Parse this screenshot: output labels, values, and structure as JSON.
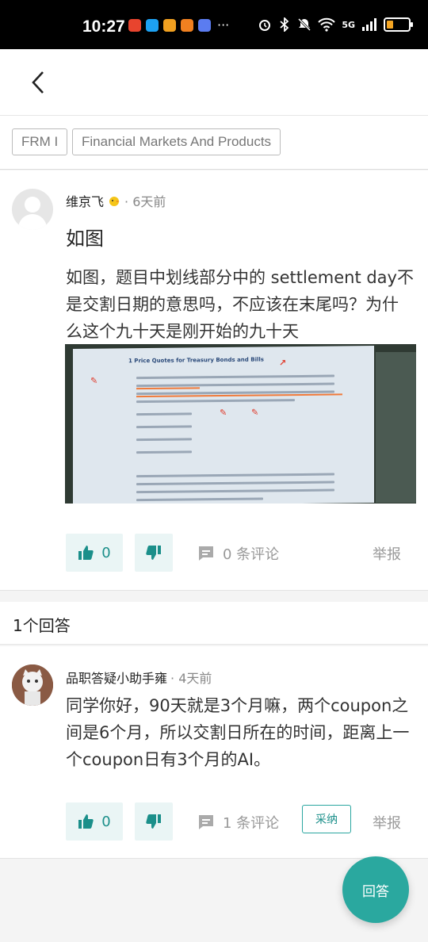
{
  "status_bar": {
    "time": "10:27",
    "more": "···",
    "network": "5G"
  },
  "tags": [
    "FRM I",
    "Financial Markets And Products"
  ],
  "question": {
    "author": "维京飞",
    "time": "6天前",
    "title": "如图",
    "body": "如图，题目中划线部分中的 settlement  day不是交割日期的意思吗，不应该在末尾吗？为什么这个九十天是刚开始的九十天",
    "image": {
      "section": "1    Price Quotes for Treasury Bonds and Bills"
    },
    "likes": "0",
    "comments": "0 条评论",
    "report": "举报"
  },
  "answer_count": "1个回答",
  "answer": {
    "author": "品职答疑小助手雍",
    "time": "4天前",
    "body": "同学你好，90天就是3个月嘛，两个coupon之间是6个月，所以交割日所在的时间，距离上一个coupon日有3个月的AI。",
    "likes": "0",
    "comments": "1 条评论",
    "accept": "采纳",
    "report": "举报"
  },
  "fab_label": "回答",
  "colors": {
    "accent": "#2aa89f",
    "accent_light": "#eaf5f5"
  }
}
